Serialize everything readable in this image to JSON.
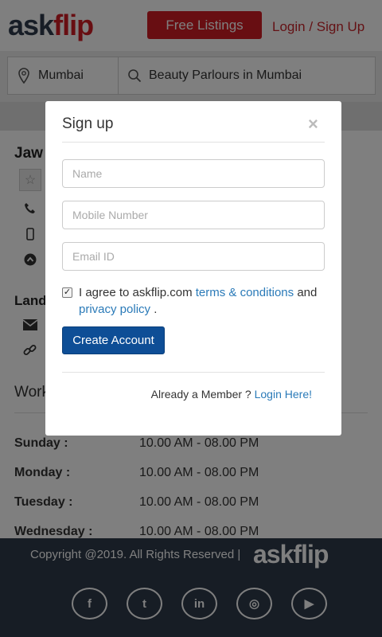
{
  "header": {
    "logo_part1": "ask",
    "logo_part2": "flip",
    "free_listings": "Free Listings",
    "login_signup": "Login / Sign Up",
    "brand_red": "#d11d24"
  },
  "search": {
    "city": "Mumbai",
    "query": "Beauty Parlours in Mumbai"
  },
  "business": {
    "name_partial": "Jaw",
    "landline_partial": "Land",
    "mobile_partial": "+"
  },
  "working_hours": {
    "title_partial": "Work",
    "rows": [
      {
        "day": "Sunday :",
        "time": "10.00 AM - 08.00 PM"
      },
      {
        "day": "Monday :",
        "time": "10.00 AM - 08.00 PM"
      },
      {
        "day": "Tuesday :",
        "time": "10.00 AM - 08.00 PM"
      },
      {
        "day": "Wednesday :",
        "time": "10.00 AM - 08.00 PM"
      }
    ]
  },
  "modal": {
    "title": "Sign up",
    "close": "×",
    "name_placeholder": "Name",
    "mobile_placeholder": "Mobile Number",
    "email_placeholder": "Email ID",
    "agree_prefix": "I agree to askflip.com",
    "terms_link": "terms & conditions",
    "and_text": "and",
    "privacy_link": "privacy policy",
    "agree_suffix": ".",
    "create_button": "Create Account",
    "member_text": "Already a Member ?",
    "login_here": "Login Here!",
    "checked": true
  },
  "footer": {
    "copyright": "Copyright @2019. All Rights Reserved |",
    "logo": "askflip",
    "socials": [
      {
        "icon": "facebook-icon",
        "glyph": "f"
      },
      {
        "icon": "twitter-icon",
        "glyph": "t"
      },
      {
        "icon": "linkedin-icon",
        "glyph": "in"
      },
      {
        "icon": "instagram-icon",
        "glyph": "◎"
      },
      {
        "icon": "youtube-icon",
        "glyph": "▶"
      }
    ]
  }
}
